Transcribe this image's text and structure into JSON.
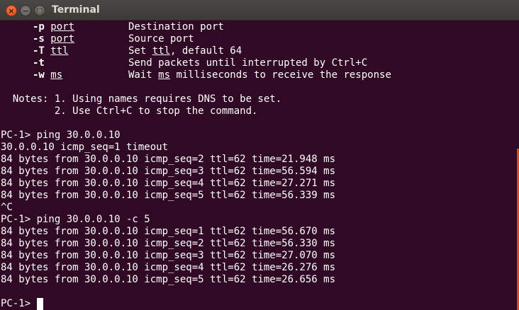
{
  "window": {
    "title": "Terminal",
    "close_glyph": "×",
    "minimize_glyph": "−",
    "maximize_glyph": "□"
  },
  "options": [
    {
      "flag": "-p",
      "arg": "port",
      "desc_before": "Destination port",
      "desc_u": "",
      "desc_after": ""
    },
    {
      "flag": "-s",
      "arg": "port",
      "desc_before": "Source port",
      "desc_u": "",
      "desc_after": ""
    },
    {
      "flag": "-T",
      "arg": "ttl",
      "desc_before": "Set ",
      "desc_u": "ttl",
      "desc_after": ", default 64"
    },
    {
      "flag": "-t",
      "arg": "",
      "desc_before": "Send packets until interrupted by Ctrl+C",
      "desc_u": "",
      "desc_after": ""
    },
    {
      "flag": "-w",
      "arg": "ms",
      "desc_before": "Wait ",
      "desc_u": "ms",
      "desc_after": " milliseconds to receive the response"
    }
  ],
  "notes": [
    "  Notes: 1. Using names requires DNS to be set.",
    "         2. Use Ctrl+C to stop the command."
  ],
  "output": [
    "PC-1> ping 30.0.0.10",
    "30.0.0.10 icmp_seq=1 timeout",
    "84 bytes from 30.0.0.10 icmp_seq=2 ttl=62 time=21.948 ms",
    "84 bytes from 30.0.0.10 icmp_seq=3 ttl=62 time=56.594 ms",
    "84 bytes from 30.0.0.10 icmp_seq=4 ttl=62 time=27.271 ms",
    "84 bytes from 30.0.0.10 icmp_seq=5 ttl=62 time=56.339 ms",
    "^C",
    "PC-1> ping 30.0.0.10 -c 5",
    "84 bytes from 30.0.0.10 icmp_seq=1 ttl=62 time=56.670 ms",
    "84 bytes from 30.0.0.10 icmp_seq=2 ttl=62 time=56.330 ms",
    "84 bytes from 30.0.0.10 icmp_seq=3 ttl=62 time=27.070 ms",
    "84 bytes from 30.0.0.10 icmp_seq=4 ttl=62 time=26.276 ms",
    "84 bytes from 30.0.0.10 icmp_seq=5 ttl=62 time=26.656 ms"
  ],
  "prompt": "PC-1> ",
  "colors": {
    "background": "#300a24",
    "text": "#ffffff",
    "titlebar": "#3c3b37",
    "close_button": "#dc4e1c",
    "scrollbar": "#dd4814"
  }
}
